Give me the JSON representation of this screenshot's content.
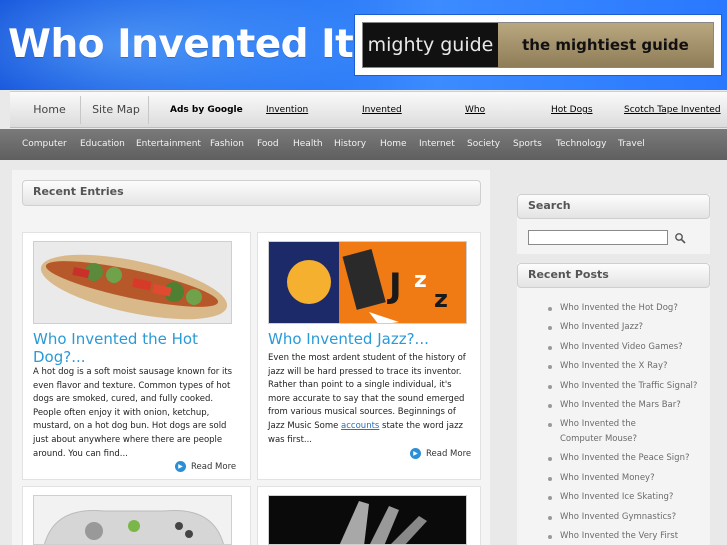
{
  "header": {
    "logo": "Who Invented It",
    "banner_left": "mighty guide",
    "banner_right": "the mightiest guide"
  },
  "topnav": {
    "home": "Home",
    "sitemap": "Site Map",
    "ads_label": "Ads by Google",
    "ad_links": [
      "Invention",
      "Invented",
      "Who",
      "Hot Dogs",
      "Scotch Tape Invented"
    ]
  },
  "categories": [
    "Computer",
    "Education",
    "Entertainment",
    "Fashion",
    "Food",
    "Health",
    "History",
    "Home",
    "Internet",
    "Society",
    "Sports",
    "Technology",
    "Travel"
  ],
  "main": {
    "section_title": "Recent Entries",
    "posts": [
      {
        "title": "Who Invented the Hot Dog?...",
        "excerpt": "A hot dog is a soft moist sausage known for its even flavor and texture. Common types of hot dogs are smoked, cured, and fully cooked. People often enjoy it with onion, ketchup, mustard, on a hot dog bun. Hot dogs are sold just about anywhere where there are people around. You can find...",
        "read_more": "Read More"
      },
      {
        "title": "Who Invented Jazz?...",
        "excerpt_before": "Even the most ardent student of the history of jazz will be hard pressed to trace its inventor. Rather than point to a single individual, it's more accurate to say that the sound emerged from various musical sources. Beginnings of Jazz Music Some ",
        "excerpt_link": "accounts",
        "excerpt_after": " state the word jazz was first...",
        "read_more": "Read More"
      }
    ]
  },
  "sidebar": {
    "search_title": "Search",
    "recent_title": "Recent Posts",
    "recent_posts": [
      "Who Invented the Hot Dog?",
      "Who Invented Jazz?",
      "Who Invented Video Games?",
      "Who Invented the X Ray?",
      "Who Invented the Traffic Signal?",
      "Who Invented the Mars Bar?",
      "Who Invented the Computer Mouse?",
      "Who Invented the Peace Sign?",
      "Who Invented Money?",
      "Who Invented Ice Skating?",
      "Who Invented Gymnastics?",
      "Who Invented the Very First"
    ]
  },
  "colors": {
    "header_blue": "#1e6cf0",
    "title_blue": "#2a9ad8",
    "category_bar": "#6a6a6a"
  }
}
